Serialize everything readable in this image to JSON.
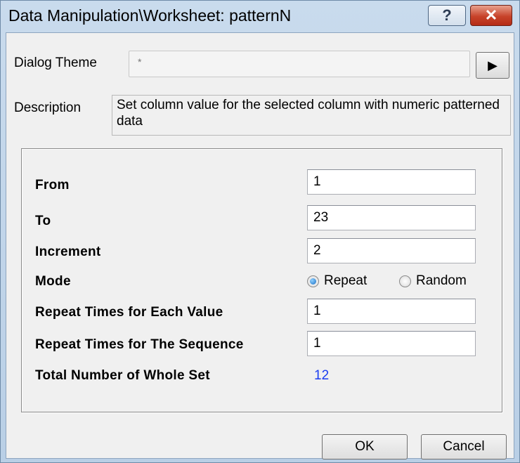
{
  "window": {
    "title": "Data Manipulation\\Worksheet: patternN",
    "help_glyph": "?",
    "close_glyph": "✕"
  },
  "theme": {
    "label": "Dialog Theme",
    "value": "*",
    "arrow_glyph": "▶"
  },
  "description": {
    "label": "Description",
    "text": "Set column value for the selected column with numeric patterned data"
  },
  "params": {
    "from_label": "From",
    "from_value": "1",
    "to_label": "To",
    "to_value": "23",
    "increment_label": "Increment",
    "increment_value": "2",
    "mode_label": "Mode",
    "mode_options": [
      "Repeat",
      "Random"
    ],
    "mode_selected": "Repeat",
    "repeat_each_label": "Repeat Times for Each Value",
    "repeat_each_value": "1",
    "repeat_seq_label": "Repeat Times for The Sequence",
    "repeat_seq_value": "1",
    "total_label": "Total Number of Whole Set",
    "total_value": "12"
  },
  "buttons": {
    "ok": "OK",
    "cancel": "Cancel"
  },
  "colors": {
    "total_value": "#1a3df0",
    "close_button": "#c7432a"
  }
}
